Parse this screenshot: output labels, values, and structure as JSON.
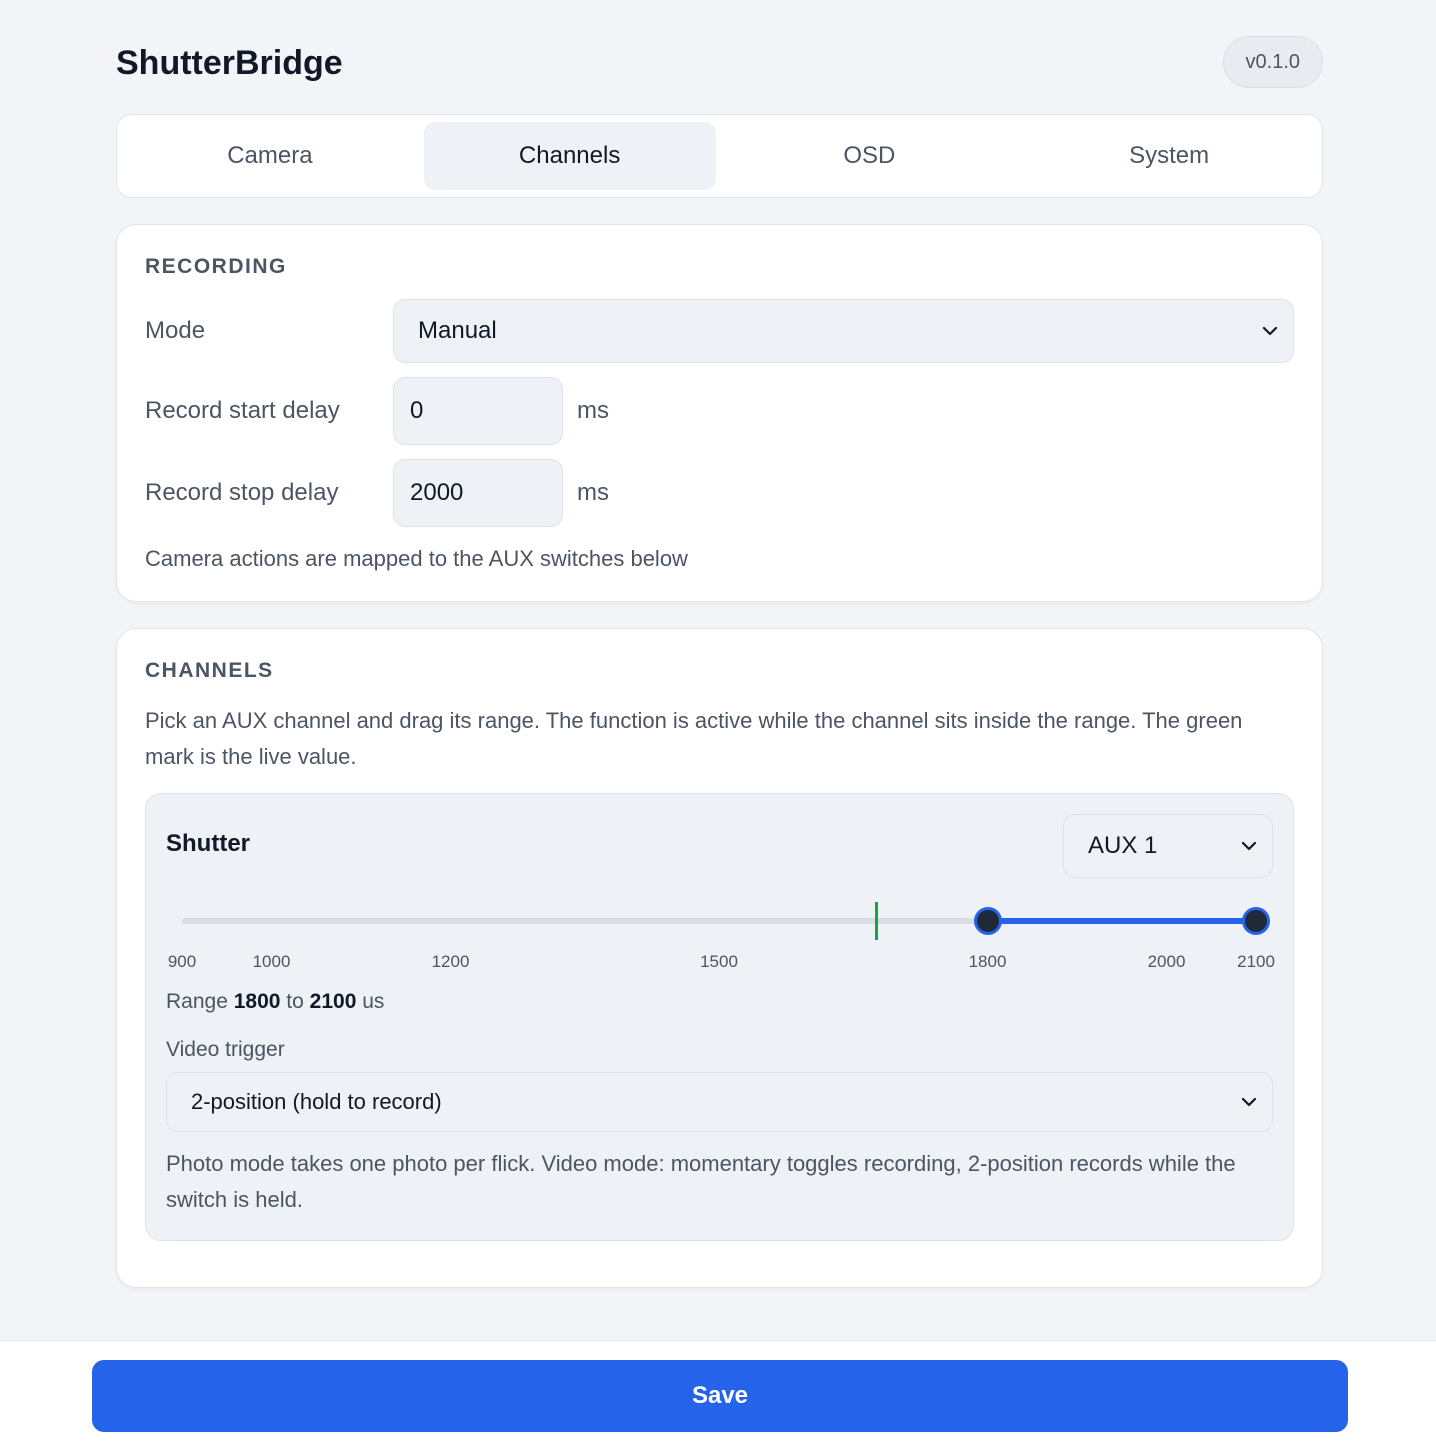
{
  "app": {
    "title": "ShutterBridge",
    "version": "v0.1.0"
  },
  "tabs": [
    {
      "label": "Camera",
      "active": false
    },
    {
      "label": "Channels",
      "active": true
    },
    {
      "label": "OSD",
      "active": false
    },
    {
      "label": "System",
      "active": false
    }
  ],
  "recording": {
    "title": "RECORDING",
    "mode_label": "Mode",
    "mode_value": "Manual",
    "start_delay_label": "Record start delay",
    "start_delay_value": "0",
    "start_delay_unit": "ms",
    "stop_delay_label": "Record stop delay",
    "stop_delay_value": "2000",
    "stop_delay_unit": "ms",
    "hint": "Camera actions are mapped to the AUX switches below"
  },
  "channels": {
    "title": "CHANNELS",
    "description": "Pick an AUX channel and drag its range. The function is active while the channel sits inside the range. The green mark is the live value.",
    "shutter": {
      "title": "Shutter",
      "aux_value": "AUX 1",
      "slider": {
        "min": 900,
        "max": 2100,
        "range_low": 1800,
        "range_high": 2100,
        "live_value": 1675,
        "ticks": [
          "900",
          "1000",
          "1200",
          "1500",
          "1800",
          "2000",
          "2100"
        ]
      },
      "range_prefix": "Range",
      "range_low_text": "1800",
      "range_to": "to",
      "range_high_text": "2100",
      "range_unit": "us",
      "trigger_label": "Video trigger",
      "trigger_value": "2-position (hold to record)",
      "hint": "Photo mode takes one photo per flick. Video mode: momentary toggles recording, 2-position records while the switch is held."
    }
  },
  "footer": {
    "save_label": "Save"
  },
  "colors": {
    "accent": "#2563eb",
    "live": "#16a34a",
    "handle": "#1f2937"
  }
}
